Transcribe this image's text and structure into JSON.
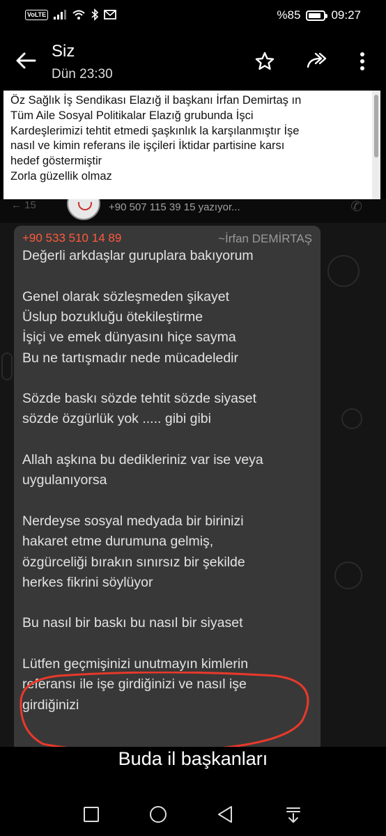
{
  "status_bar": {
    "volte": "VoLTE",
    "battery_text": "%85",
    "battery_level": 0.85,
    "time": "09:27"
  },
  "header": {
    "sender": "Siz",
    "date": "Dün 23:30",
    "icons": [
      "back-arrow-icon",
      "star-icon",
      "forward-icon",
      "more-vert-icon"
    ]
  },
  "caption": {
    "lines": [
      "Öz Sağlık İş Sendikası Elazığ il başkanı İrfan Demirtaş ın",
      "Tüm Aile Sosyal Politikalar Elazığ grubunda İşci",
      "Kardeşlerimizi tehtit etmedi şaşkınlık la karşılanmıştır İşe",
      "nasıl ve kimin referans ile işçileri İktidar partisine karsı",
      "hedef göstermiştir",
      "Zorla güzellik olmaz"
    ]
  },
  "inner_chat": {
    "back_text": "← 15",
    "typing": "+90 507 115 39 15 yazıyor...",
    "message": {
      "sender_phone": "+90 533 510 14 89",
      "sender_alias": "~İrfan DEMİRTAŞ",
      "lines": [
        "Değerli arkdaşlar guruplara bakıyorum",
        "",
        "Genel olarak sözleşmeden şikayet",
        "Üslup bozukluğu ötekileştirme",
        "İşiçi ve emek dünyasını hiçe sayma",
        "Bu ne tartışmadır nede mücadeledir",
        "",
        "Sözde baskı sözde tehtit sözde siyaset",
        "sözde özgürlük yok ..... gibi gibi",
        "",
        "Allah aşkına bu dedikleriniz var ise veya",
        "uygulanıyorsa",
        "",
        "Nerdeyse sosyal medyada bir birinizi",
        "hakaret etme durumuna gelmiş,",
        "özgürceliği bırakın sınırsız bir şekilde",
        "herkes fikrini söylüyor",
        "",
        "Bu nasıl bir baskı bu nasıl bir siyaset",
        "",
        "Lütfen geçmişinizi unutmayın kimlerin",
        "referansı ile işe girdiğinizi ve nasıl işe",
        "girdiğinizi"
      ],
      "annotation_color": "#e8392a"
    }
  },
  "final_caption": "Buda il başkanları",
  "nav_bar": {
    "icons": [
      "recents-square-icon",
      "home-circle-icon",
      "back-triangle-icon",
      "notification-pull-icon"
    ]
  }
}
